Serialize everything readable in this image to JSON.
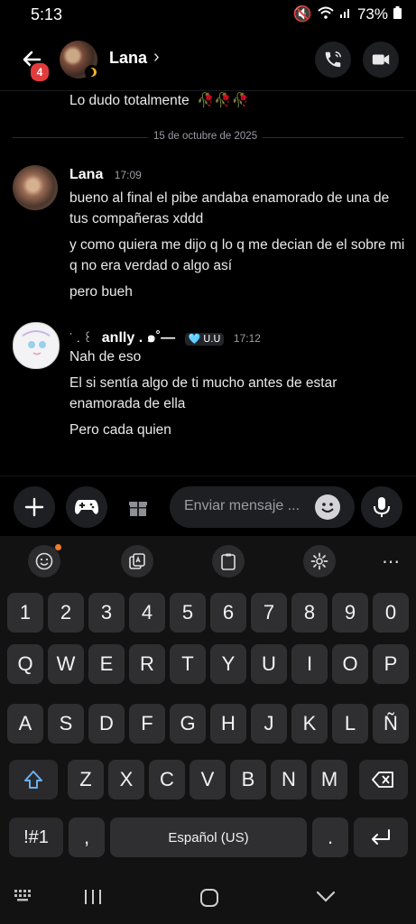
{
  "status": {
    "time": "5:13",
    "battery": "73%"
  },
  "header": {
    "name": "Lana",
    "chevron": "›",
    "badge": "4"
  },
  "messages": {
    "prev_text": "Lo dudo totalmente",
    "prev_emojis": "🥀🥀🥀",
    "date": "15 de octubre de 2025",
    "lana": {
      "name": "Lana",
      "time": "17:09",
      "lines": [
        "bueno al final el pibe andaba enamorado de una de tus compañeras xddd",
        "y como quiera me dijo q lo q me decian de el sobre mi q no era verdad o algo así",
        "pero bueh"
      ]
    },
    "anlly": {
      "name_prefix": "˙ . ꒰",
      "name": "anlly . ๑˚—",
      "tag": "🩵 ᑌ.ᑌ",
      "time": "17:12",
      "lines": [
        "Nah de eso",
        "El si sentía algo de ti mucho antes de estar enamorada de ella",
        "Pero cada quien"
      ]
    }
  },
  "composer": {
    "placeholder": "Enviar mensaje ..."
  },
  "keyboard": {
    "row_numbers": [
      "1",
      "2",
      "3",
      "4",
      "5",
      "6",
      "7",
      "8",
      "9",
      "0"
    ],
    "row_q": [
      "Q",
      "W",
      "E",
      "R",
      "T",
      "Y",
      "U",
      "I",
      "O",
      "P"
    ],
    "row_a": [
      "A",
      "S",
      "D",
      "F",
      "G",
      "H",
      "J",
      "K",
      "L",
      "Ñ"
    ],
    "row_z": [
      "Z",
      "X",
      "C",
      "V",
      "B",
      "N",
      "M"
    ],
    "symbols": "!#1",
    "comma": ",",
    "space": "Español (US)",
    "period": "."
  },
  "colors": {
    "accent_badge": "#e23b3b",
    "background": "#000000",
    "bubble": "#1e1f22"
  }
}
